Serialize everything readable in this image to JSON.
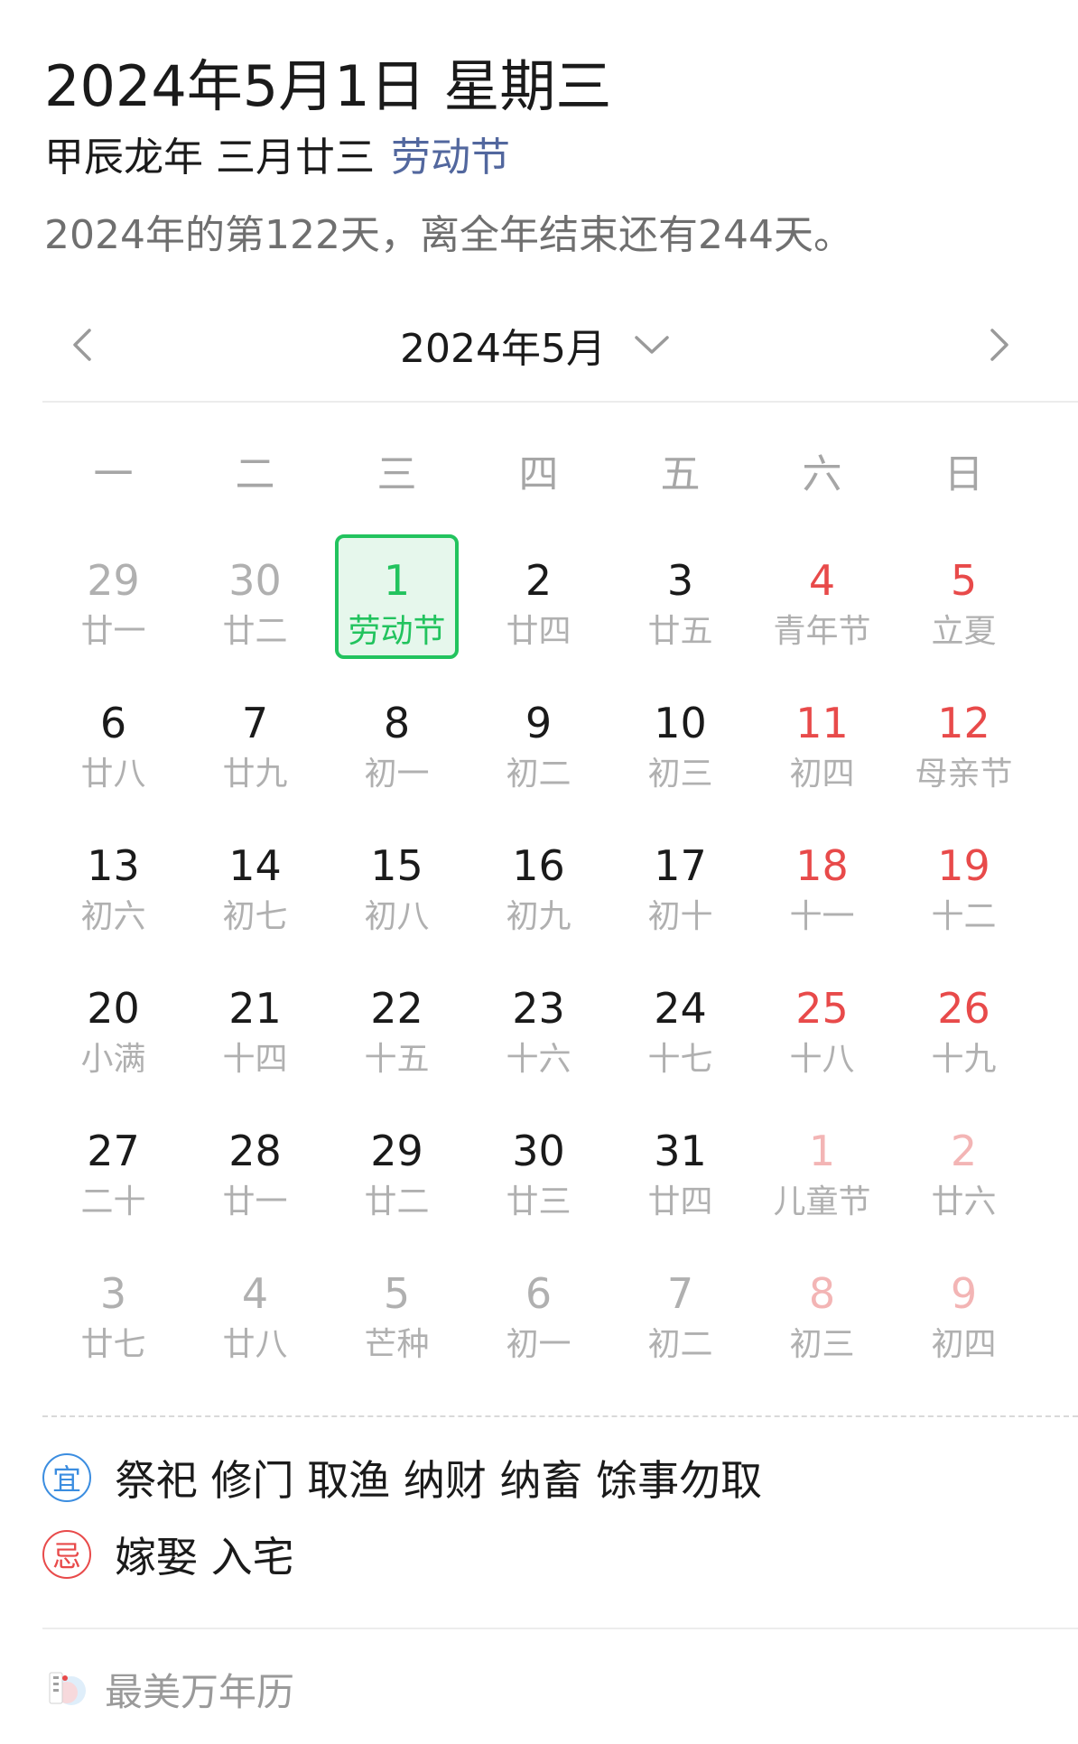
{
  "header": {
    "date_title": "2024年5月1日 星期三",
    "lunar": "甲辰龙年 三月廿三",
    "festival": "劳动节",
    "day_of_year": "2024年的第122天，离全年结束还有244天。"
  },
  "nav": {
    "month_label": "2024年5月",
    "prev_icon": "chevron-left-icon",
    "next_icon": "chevron-right-icon",
    "dropdown_icon": "chevron-down-icon"
  },
  "weekdays": [
    "一",
    "二",
    "三",
    "四",
    "五",
    "六",
    "日"
  ],
  "colors": {
    "selected_border": "#22c35e",
    "selected_bg": "#e6f7ec",
    "weekend": "#e84a4a",
    "weekend_faded": "#f3b5b5",
    "other_month": "#b0b0b0",
    "festival_link": "#52679e"
  },
  "days": [
    {
      "num": "29",
      "lunar": "廿一",
      "state": "other"
    },
    {
      "num": "30",
      "lunar": "廿二",
      "state": "other"
    },
    {
      "num": "1",
      "lunar": "劳动节",
      "state": "selected"
    },
    {
      "num": "2",
      "lunar": "廿四",
      "state": "normal"
    },
    {
      "num": "3",
      "lunar": "廿五",
      "state": "normal"
    },
    {
      "num": "4",
      "lunar": "青年节",
      "state": "weekend"
    },
    {
      "num": "5",
      "lunar": "立夏",
      "state": "weekend"
    },
    {
      "num": "6",
      "lunar": "廿八",
      "state": "normal"
    },
    {
      "num": "7",
      "lunar": "廿九",
      "state": "normal"
    },
    {
      "num": "8",
      "lunar": "初一",
      "state": "normal"
    },
    {
      "num": "9",
      "lunar": "初二",
      "state": "normal"
    },
    {
      "num": "10",
      "lunar": "初三",
      "state": "normal"
    },
    {
      "num": "11",
      "lunar": "初四",
      "state": "weekend"
    },
    {
      "num": "12",
      "lunar": "母亲节",
      "state": "weekend"
    },
    {
      "num": "13",
      "lunar": "初六",
      "state": "normal"
    },
    {
      "num": "14",
      "lunar": "初七",
      "state": "normal"
    },
    {
      "num": "15",
      "lunar": "初八",
      "state": "normal"
    },
    {
      "num": "16",
      "lunar": "初九",
      "state": "normal"
    },
    {
      "num": "17",
      "lunar": "初十",
      "state": "normal"
    },
    {
      "num": "18",
      "lunar": "十一",
      "state": "weekend"
    },
    {
      "num": "19",
      "lunar": "十二",
      "state": "weekend"
    },
    {
      "num": "20",
      "lunar": "小满",
      "state": "normal"
    },
    {
      "num": "21",
      "lunar": "十四",
      "state": "normal"
    },
    {
      "num": "22",
      "lunar": "十五",
      "state": "normal"
    },
    {
      "num": "23",
      "lunar": "十六",
      "state": "normal"
    },
    {
      "num": "24",
      "lunar": "十七",
      "state": "normal"
    },
    {
      "num": "25",
      "lunar": "十八",
      "state": "weekend"
    },
    {
      "num": "26",
      "lunar": "十九",
      "state": "weekend"
    },
    {
      "num": "27",
      "lunar": "二十",
      "state": "normal"
    },
    {
      "num": "28",
      "lunar": "廿一",
      "state": "normal"
    },
    {
      "num": "29",
      "lunar": "廿二",
      "state": "normal"
    },
    {
      "num": "30",
      "lunar": "廿三",
      "state": "normal"
    },
    {
      "num": "31",
      "lunar": "廿四",
      "state": "normal"
    },
    {
      "num": "1",
      "lunar": "儿童节",
      "state": "other-weekend"
    },
    {
      "num": "2",
      "lunar": "廿六",
      "state": "other-weekend"
    },
    {
      "num": "3",
      "lunar": "廿七",
      "state": "other"
    },
    {
      "num": "4",
      "lunar": "廿八",
      "state": "other"
    },
    {
      "num": "5",
      "lunar": "芒种",
      "state": "other"
    },
    {
      "num": "6",
      "lunar": "初一",
      "state": "other"
    },
    {
      "num": "7",
      "lunar": "初二",
      "state": "other"
    },
    {
      "num": "8",
      "lunar": "初三",
      "state": "other-weekend"
    },
    {
      "num": "9",
      "lunar": "初四",
      "state": "other-weekend"
    }
  ],
  "almanac": {
    "yi_label": "宜",
    "yi_items": "祭祀 修门 取渔 纳财 纳畜 馀事勿取",
    "ji_label": "忌",
    "ji_items": "嫁娶 入宅"
  },
  "footer": {
    "app_name": "最美万年历",
    "logo_icon": "app-logo-icon"
  }
}
